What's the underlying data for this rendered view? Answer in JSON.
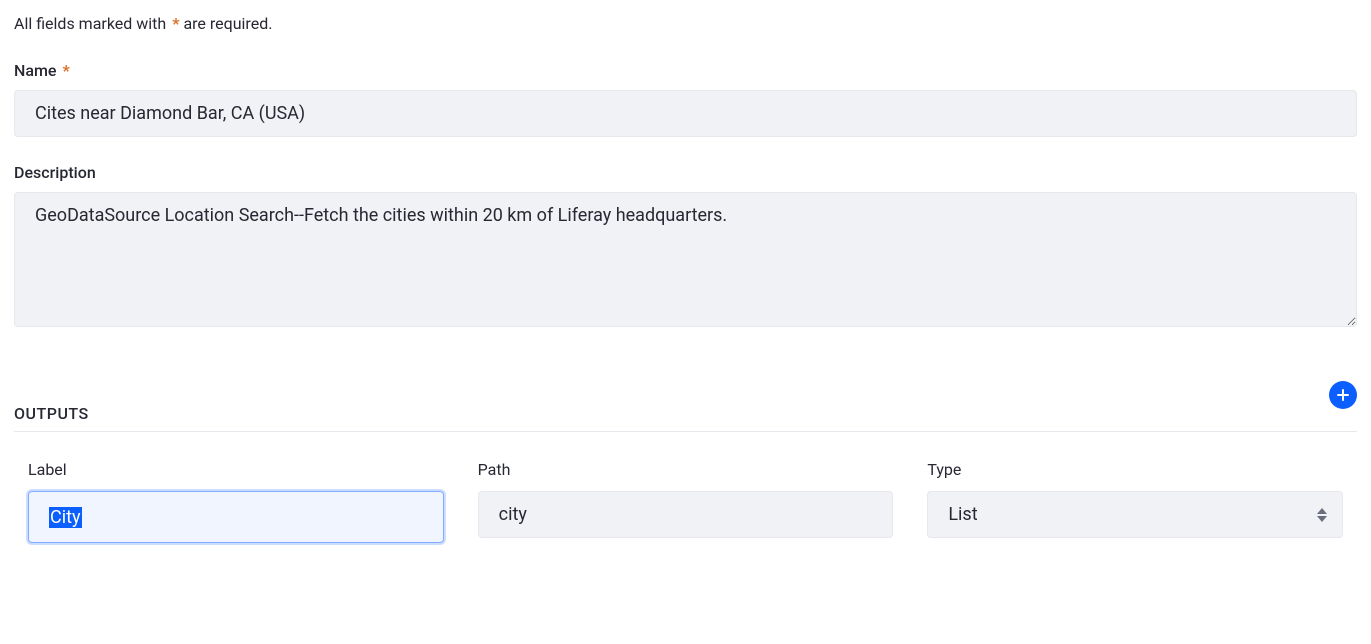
{
  "notice": {
    "prefix": "All fields marked with",
    "star": "*",
    "suffix": "are required."
  },
  "form": {
    "name": {
      "label": "Name",
      "value": "Cites near Diamond Bar, CA (USA)"
    },
    "description": {
      "label": "Description",
      "value": "GeoDataSource Location Search--Fetch the cities within 20 km of Liferay headquarters."
    }
  },
  "outputs": {
    "sectionTitle": "OUTPUTS",
    "columns": {
      "label": "Label",
      "path": "Path",
      "type": "Type"
    },
    "row": {
      "label": "City",
      "path": "city",
      "type": "List"
    }
  }
}
